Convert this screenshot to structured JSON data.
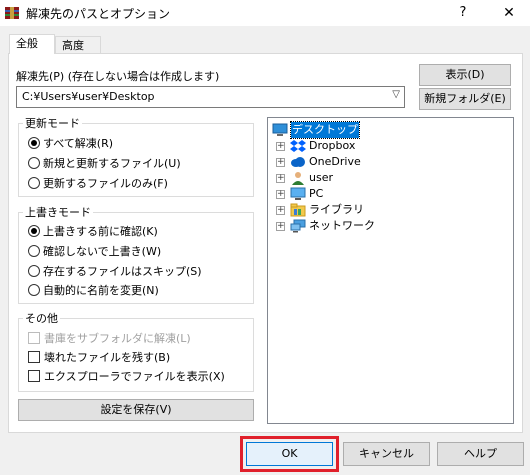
{
  "window": {
    "title": "解凍先のパスとオプション",
    "help": "?",
    "close": "✕"
  },
  "tabs": [
    {
      "label": "全般",
      "active": true
    },
    {
      "label": "高度",
      "active": false
    }
  ],
  "path": {
    "label": "解凍先(P) (存在しない場合は作成します)",
    "value": "C:¥Users¥user¥Desktop",
    "dropdown_icon": "chevron-down-icon"
  },
  "buttons": {
    "show": "表示(D)",
    "new_folder": "新規フォルダ(E)",
    "save_settings": "設定を保存(V)",
    "ok": "OK",
    "cancel": "キャンセル",
    "help": "ヘルプ"
  },
  "update_mode": {
    "title": "更新モード",
    "options": [
      {
        "label": "すべて解凍(R)",
        "selected": true
      },
      {
        "label": "新規と更新するファイル(U)",
        "selected": false
      },
      {
        "label": "更新するファイルのみ(F)",
        "selected": false
      }
    ]
  },
  "overwrite_mode": {
    "title": "上書きモード",
    "options": [
      {
        "label": "上書きする前に確認(K)",
        "selected": true
      },
      {
        "label": "確認しないで上書き(W)",
        "selected": false
      },
      {
        "label": "存在するファイルはスキップ(S)",
        "selected": false
      },
      {
        "label": "自動的に名前を変更(N)",
        "selected": false
      }
    ]
  },
  "misc": {
    "title": "その他",
    "options": [
      {
        "label": "書庫をサブフォルダに解凍(L)",
        "checked": false,
        "disabled": true
      },
      {
        "label": "壊れたファイルを残す(B)",
        "checked": false,
        "disabled": false
      },
      {
        "label": "エクスプローラでファイルを表示(X)",
        "checked": false,
        "disabled": false
      }
    ]
  },
  "tree": {
    "root": {
      "label": "デスクトップ",
      "icon": "desktop-icon",
      "selected": true
    },
    "items": [
      {
        "label": "Dropbox",
        "icon": "dropbox-icon",
        "expander": "+"
      },
      {
        "label": "OneDrive",
        "icon": "cloud-icon",
        "expander": "+"
      },
      {
        "label": "user",
        "icon": "user-icon",
        "expander": "+"
      },
      {
        "label": "PC",
        "icon": "computer-icon",
        "expander": "+"
      },
      {
        "label": "ライブラリ",
        "icon": "library-icon",
        "expander": "+"
      },
      {
        "label": "ネットワーク",
        "icon": "network-icon",
        "expander": "+"
      }
    ]
  },
  "colors": {
    "highlight": "#e0202b",
    "selection": "#0078d7",
    "ok_border": "#0078d7"
  }
}
